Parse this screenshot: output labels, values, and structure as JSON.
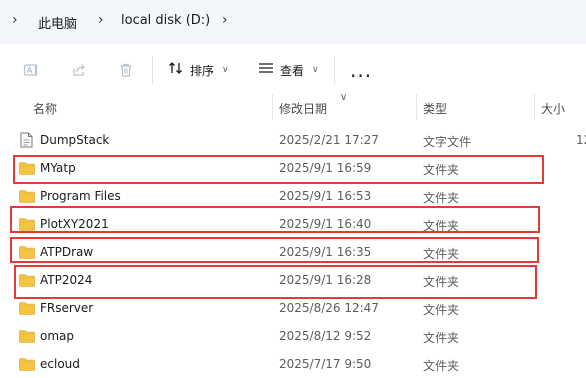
{
  "breadcrumb": {
    "items": [
      "此电脑",
      "local disk (D:)"
    ]
  },
  "toolbar": {
    "sort_label": "排序",
    "view_label": "查看",
    "more_label": "..."
  },
  "columns": {
    "name": "名称",
    "date": "修改日期",
    "type": "类型",
    "size": "大小"
  },
  "rows": [
    {
      "name": "DumpStack",
      "date": "2025/2/21 17:27",
      "type": "文字文件",
      "size": "12",
      "kind": "file",
      "highlighted": false
    },
    {
      "name": "MYatp",
      "date": "2025/9/1 16:59",
      "type": "文件夹",
      "size": "",
      "kind": "folder",
      "highlighted": true
    },
    {
      "name": "Program Files",
      "date": "2025/9/1 16:53",
      "type": "文件夹",
      "size": "",
      "kind": "folder",
      "highlighted": false
    },
    {
      "name": "PlotXY2021",
      "date": "2025/9/1 16:40",
      "type": "文件夹",
      "size": "",
      "kind": "folder",
      "highlighted": true
    },
    {
      "name": "ATPDraw",
      "date": "2025/9/1 16:35",
      "type": "文件夹",
      "size": "",
      "kind": "folder",
      "highlighted": true
    },
    {
      "name": "ATP2024",
      "date": "2025/9/1 16:28",
      "type": "文件夹",
      "size": "",
      "kind": "folder",
      "highlighted": true
    },
    {
      "name": "FRserver",
      "date": "2025/8/26 12:47",
      "type": "文件夹",
      "size": "",
      "kind": "folder",
      "highlighted": false
    },
    {
      "name": "omap",
      "date": "2025/8/12 9:52",
      "type": "文件夹",
      "size": "",
      "kind": "folder",
      "highlighted": false
    },
    {
      "name": "ecloud",
      "date": "2025/7/17 9:50",
      "type": "文件夹",
      "size": "",
      "kind": "folder",
      "highlighted": false
    }
  ],
  "colors": {
    "highlight_box": "#e03a3a",
    "folder": "#f5c445"
  }
}
